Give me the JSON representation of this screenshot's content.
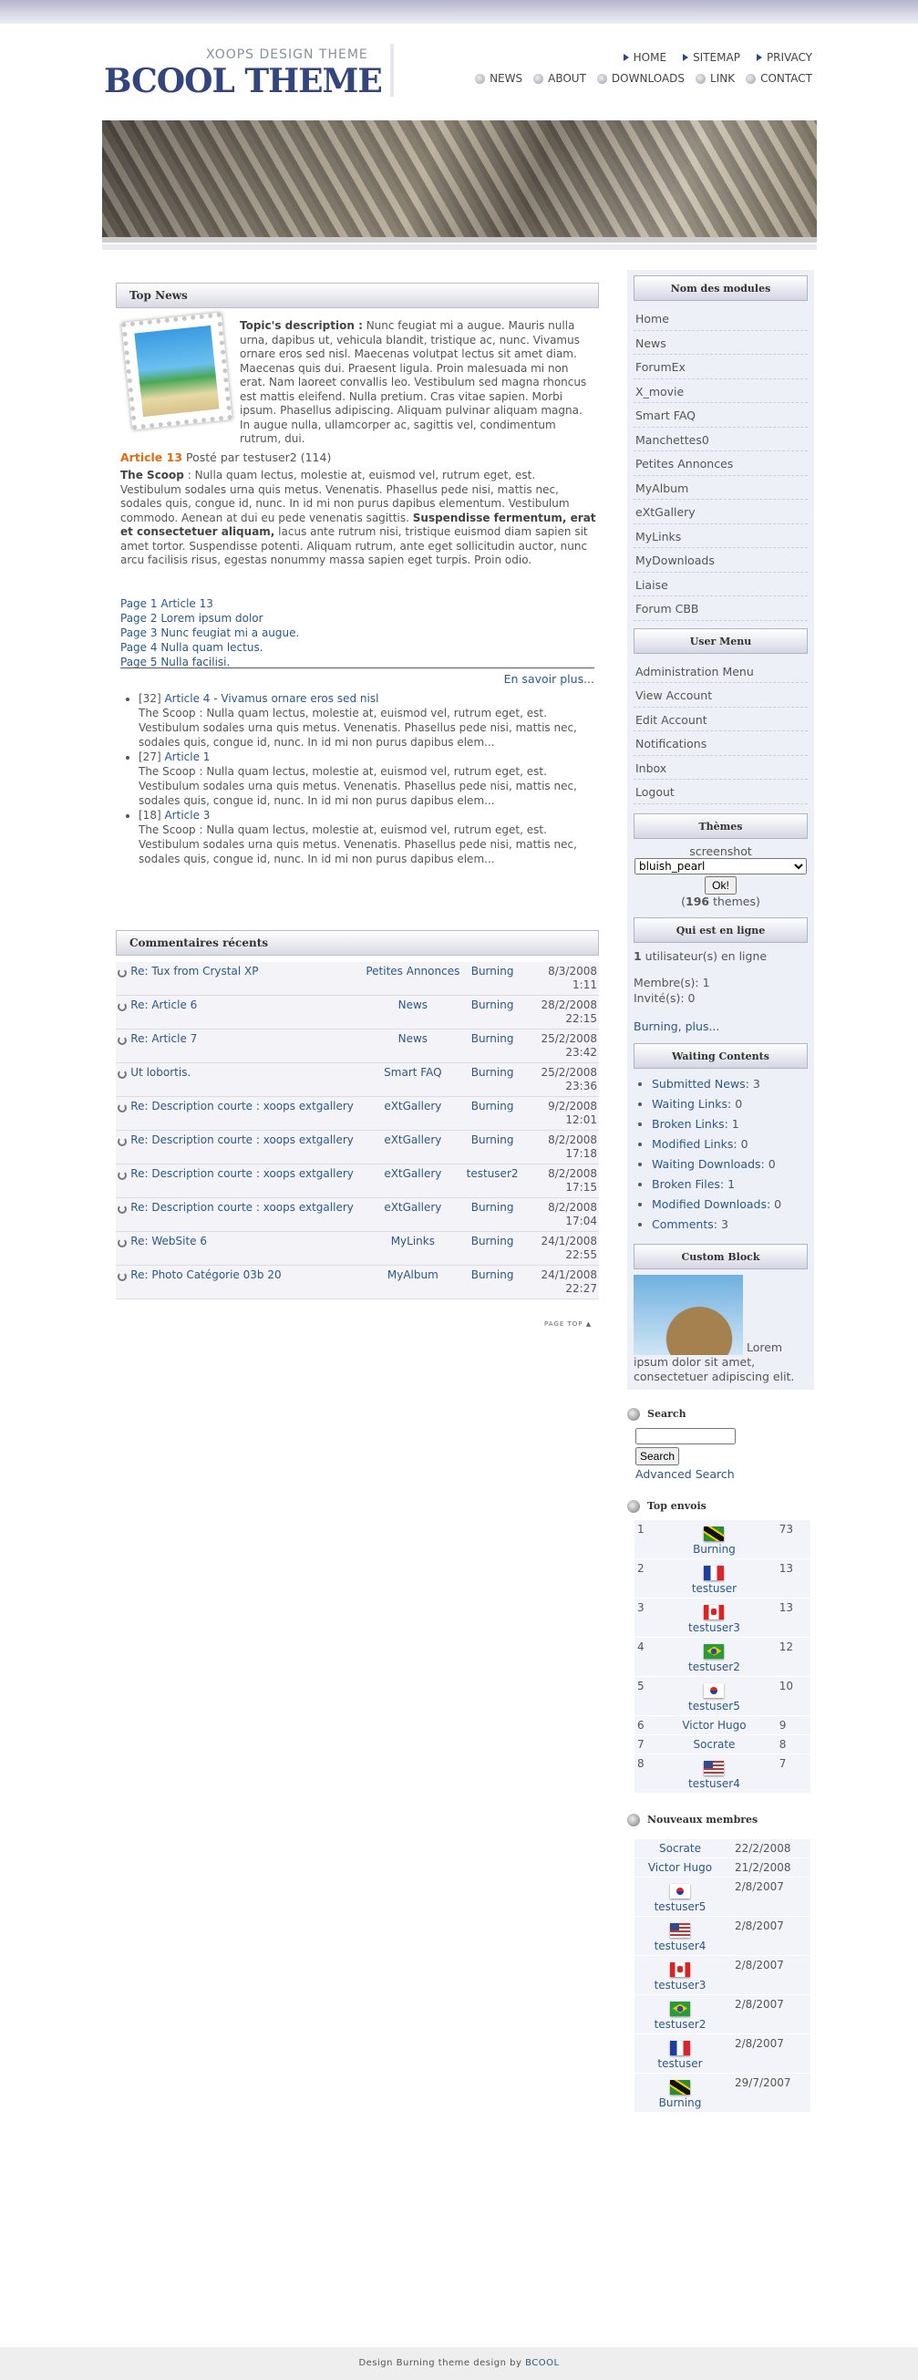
{
  "brand": {
    "subtitle": "XOOPS DESIGN THEME",
    "name": "BCOOL THEME"
  },
  "topnav": [
    "HOME",
    "SITEMAP",
    "PRIVACY"
  ],
  "mainnav": [
    "NEWS",
    "ABOUT",
    "DOWNLOADS",
    "LINK",
    "CONTACT"
  ],
  "topnews": {
    "title": "Top News",
    "desc_label": "Topic's description :",
    "desc": "Nunc feugiat mi a augue. Mauris nulla urna, dapibus ut, vehicula blandit, tristique ac, nunc. Vivamus ornare eros sed nisl. Maecenas volutpat lectus sit amet diam. Maecenas quis dui. Praesent ligula. Proin malesuada mi non erat. Nam laoreet convallis leo. Vestibulum sed magna rhoncus est mattis eleifend. Nulla pretium. Cras vitae sapien. Morbi ipsum. Phasellus adipiscing. Aliquam pulvinar aliquam magna. In augue nulla, ullamcorper ac, sagittis vel, condimentum rutrum, dui.",
    "article": "Article 13",
    "posted": " Posté par testuser2 (114)",
    "scoop_label": "The Scoop",
    "scoop": " : Nulla quam lectus, molestie at, euismod vel, rutrum eget, est. Vestibulum sodales urna quis metus. Venenatis. Phasellus pede nisi, mattis nec, sodales quis, congue id, nunc. In id mi non purus dapibus elementum. Vestibulum commodo. Aenean at dui eu pede venenatis sagittis. ",
    "scoop_bold": "Suspendisse fermentum, erat et consectetuer aliquam,",
    "scoop_end": " lacus ante rutrum nisi, tristique euismod diam sapien sit amet tortor. Suspendisse potenti. Aliquam rutrum, ante eget sollicitudin auctor, nunc arcu facilisis risus, egestas nonummy massa sapien eget turpis. Proin odio.",
    "pages": [
      "Page 1 Article 13",
      "Page 2 Lorem ipsum dolor",
      "Page 3 Nunc feugiat mi a augue.",
      "Page 4 Nulla quam lectus.",
      "Page 5 Nulla facilisi."
    ],
    "more": "En savoir plus...",
    "others": [
      {
        "num": "[32]",
        "title": "Article 4 - Vivamus ornare eros sed nisl",
        "text": "The Scoop : Nulla quam lectus, molestie at, euismod vel, rutrum eget, est. Vestibulum sodales urna quis metus. Venenatis. Phasellus pede nisi, mattis nec, sodales quis, congue id, nunc. In id mi non purus dapibus elem..."
      },
      {
        "num": "[27]",
        "title": "Article 1",
        "text": "The Scoop : Nulla quam lectus, molestie at, euismod vel, rutrum eget, est. Vestibulum sodales urna quis metus. Venenatis. Phasellus pede nisi, mattis nec, sodales quis, congue id, nunc. In id mi non purus dapibus elem..."
      },
      {
        "num": "[18]",
        "title": "Article 3",
        "text": "The Scoop : Nulla quam lectus, molestie at, euismod vel, rutrum eget, est. Vestibulum sodales urna quis metus. Venenatis. Phasellus pede nisi, mattis nec, sodales quis, congue id, nunc. In id mi non purus dapibus elem..."
      }
    ]
  },
  "comments": {
    "title": "Commentaires récents",
    "rows": [
      [
        "Re: Tux from Crystal XP",
        "Petites Annonces",
        "Burning",
        "8/3/2008 1:11"
      ],
      [
        "Re: Article 6",
        "News",
        "Burning",
        "28/2/2008 22:15"
      ],
      [
        "Re: Article 7",
        "News",
        "Burning",
        "25/2/2008 23:42"
      ],
      [
        "Ut lobortis.",
        "Smart FAQ",
        "Burning",
        "25/2/2008 23:36"
      ],
      [
        "Re: Description courte : xoops extgallery",
        "eXtGallery",
        "Burning",
        "9/2/2008 12:01"
      ],
      [
        "Re: Description courte : xoops extgallery",
        "eXtGallery",
        "Burning",
        "8/2/2008 17:18"
      ],
      [
        "Re: Description courte : xoops extgallery",
        "eXtGallery",
        "testuser2",
        "8/2/2008 17:15"
      ],
      [
        "Re: Description courte : xoops extgallery",
        "eXtGallery",
        "Burning",
        "8/2/2008 17:04"
      ],
      [
        "Re: WebSite 6",
        "MyLinks",
        "Burning",
        "24/1/2008 22:55"
      ],
      [
        "Re: Photo Catégorie 03b 20",
        "MyAlbum",
        "Burning",
        "24/1/2008 22:27"
      ]
    ],
    "pagetop": "PAGE TOP ▲"
  },
  "modules": {
    "title": "Nom des modules",
    "items": [
      "Home",
      "News",
      "ForumEx",
      "X_movie",
      "Smart FAQ",
      "Manchettes0",
      "Petites Annonces",
      "MyAlbum",
      "eXtGallery",
      "MyLinks",
      "MyDownloads",
      "Liaise",
      "Forum CBB"
    ]
  },
  "usermenu": {
    "title": "User Menu",
    "items": [
      "Administration Menu",
      "View Account",
      "Edit Account",
      "Notifications",
      "Inbox",
      "Logout"
    ]
  },
  "themes": {
    "title": "Thèmes",
    "label": "screenshot",
    "selected": "bluish_pearl",
    "button": "Ok!",
    "count": "196",
    "count_suffix": " themes)"
  },
  "online": {
    "title": "Qui est en ligne",
    "count": "1",
    "users": " utilisateur(s) en ligne",
    "members": "Membre(s): 1",
    "guests": "Invité(s): 0",
    "link": "Burning, plus..."
  },
  "waiting": {
    "title": "Waiting Contents",
    "items": [
      {
        "label": "Submitted News:",
        "value": "3"
      },
      {
        "label": "Waiting Links:",
        "value": "0"
      },
      {
        "label": "Broken Links:",
        "value": "1"
      },
      {
        "label": "Modified Links:",
        "value": "0"
      },
      {
        "label": "Waiting Downloads:",
        "value": "0"
      },
      {
        "label": "Broken Files:",
        "value": "1"
      },
      {
        "label": "Modified Downloads:",
        "value": "0"
      },
      {
        "label": "Comments:",
        "value": "3"
      }
    ]
  },
  "custom": {
    "title": "Custom Block",
    "text": "Lorem ipsum dolor sit amet, consectetuer adipiscing elit."
  },
  "search": {
    "title": "Search",
    "button": "Search",
    "advanced": "Advanced Search"
  },
  "topposters": {
    "title": "Top envois",
    "rows": [
      {
        "rank": "1",
        "name": "Burning",
        "flag": "jm",
        "posts": "73"
      },
      {
        "rank": "2",
        "name": "testuser",
        "flag": "fr",
        "posts": "13"
      },
      {
        "rank": "3",
        "name": "testuser3",
        "flag": "ca",
        "posts": "13"
      },
      {
        "rank": "4",
        "name": "testuser2",
        "flag": "br",
        "posts": "12"
      },
      {
        "rank": "5",
        "name": "testuser5",
        "flag": "kr",
        "posts": "10"
      },
      {
        "rank": "6",
        "name": "Victor Hugo",
        "flag": "",
        "posts": "9"
      },
      {
        "rank": "7",
        "name": "Socrate",
        "flag": "",
        "posts": "8"
      },
      {
        "rank": "8",
        "name": "testuser4",
        "flag": "us",
        "posts": "7"
      }
    ]
  },
  "newmembers": {
    "title": "Nouveaux membres",
    "rows": [
      {
        "name": "Socrate",
        "flag": "",
        "date": "22/2/2008"
      },
      {
        "name": "Victor Hugo",
        "flag": "",
        "date": "21/2/2008"
      },
      {
        "name": "testuser5",
        "flag": "kr",
        "date": "2/8/2007"
      },
      {
        "name": "testuser4",
        "flag": "us",
        "date": "2/8/2007"
      },
      {
        "name": "testuser3",
        "flag": "ca",
        "date": "2/8/2007"
      },
      {
        "name": "testuser2",
        "flag": "br",
        "date": "2/8/2007"
      },
      {
        "name": "testuser",
        "flag": "fr",
        "date": "2/8/2007"
      },
      {
        "name": "Burning",
        "flag": "jm",
        "date": "29/7/2007"
      }
    ]
  },
  "footer": {
    "text": "Design Burning theme design by ",
    "link": "BCOOL"
  }
}
